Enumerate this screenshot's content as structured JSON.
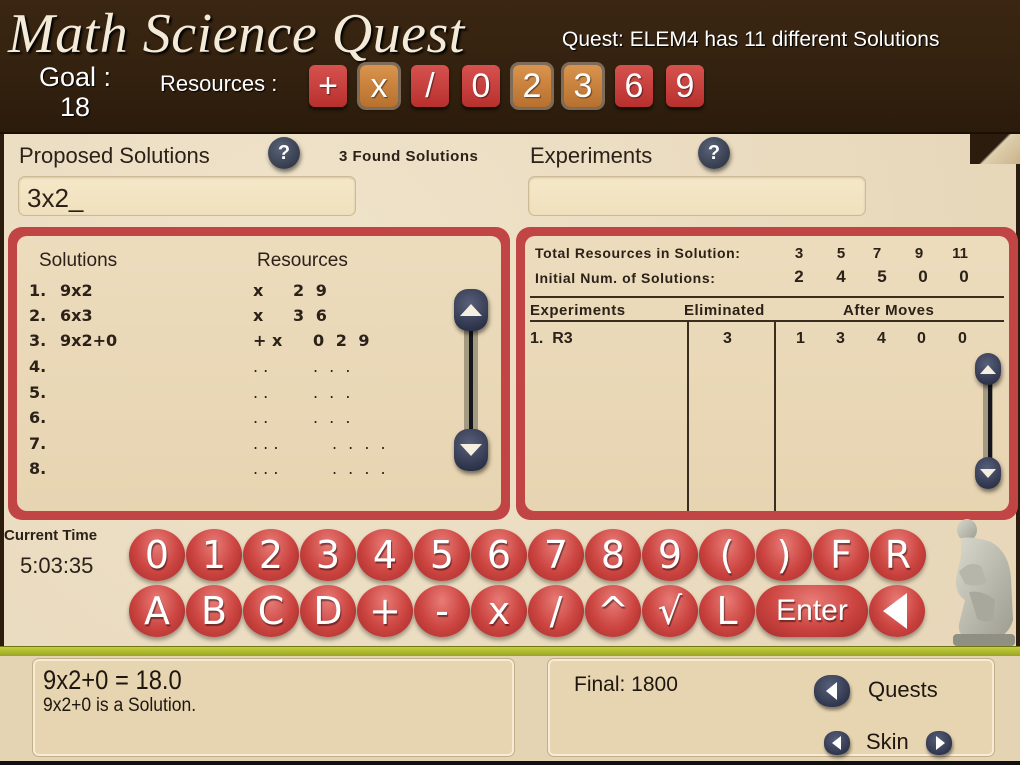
{
  "header": {
    "title": "Math Science Quest",
    "quest_text": "Quest: ELEM4 has 11 different Solutions",
    "goal_label": "Goal :",
    "goal_value": "18",
    "resources_label": "Resources :",
    "resource_tiles": [
      {
        "label": "+",
        "state": "available"
      },
      {
        "label": "x",
        "state": "used"
      },
      {
        "label": "/",
        "state": "available"
      },
      {
        "label": "0",
        "state": "available"
      },
      {
        "label": "2",
        "state": "used"
      },
      {
        "label": "3",
        "state": "used"
      },
      {
        "label": "6",
        "state": "available"
      },
      {
        "label": "9",
        "state": "available"
      }
    ]
  },
  "proposed": {
    "label": "Proposed Solutions",
    "help": "?",
    "found_text": "3 Found Solutions",
    "input_value": "3x2_"
  },
  "experiments_input": {
    "label": "Experiments",
    "help": "?",
    "input_value": ""
  },
  "solutions_panel": {
    "col_solutions": "Solutions",
    "col_resources": "Resources",
    "rows": [
      {
        "num": "1.",
        "expr": "9x2",
        "ops": "x",
        "digits": "2 9"
      },
      {
        "num": "2.",
        "expr": "6x3",
        "ops": "x",
        "digits": "3 6"
      },
      {
        "num": "3.",
        "expr": "9x2+0",
        "ops": "+ x",
        "digits": "0 2 9"
      },
      {
        "num": "4.",
        "expr": "",
        "ops": ". .",
        "digits": ". . ."
      },
      {
        "num": "5.",
        "expr": "",
        "ops": ". .",
        "digits": ". . ."
      },
      {
        "num": "6.",
        "expr": "",
        "ops": ". .",
        "digits": ". . ."
      },
      {
        "num": "7.",
        "expr": "",
        "ops": ". . .",
        "digits": ". . . ."
      },
      {
        "num": "8.",
        "expr": "",
        "ops": ". . .",
        "digits": ". . . ."
      }
    ]
  },
  "experiments_panel": {
    "total_label": "Total Resources in Solution:",
    "total_values": [
      "3",
      "5",
      "7",
      "9",
      "11"
    ],
    "initial_label": "Initial Num. of Solutions:",
    "initial_values": [
      "2",
      "4",
      "5",
      "0",
      "0"
    ],
    "col_experiments": "Experiments",
    "col_eliminated": "Eliminated",
    "col_after": "After Moves",
    "rows": [
      {
        "experiment": "1.  R3",
        "eliminated": "3",
        "after": [
          "1",
          "3",
          "4",
          "0",
          "0"
        ]
      }
    ]
  },
  "clock": {
    "label": "Current Time",
    "value": "5:03:35"
  },
  "keypad": {
    "row1": [
      "0",
      "1",
      "2",
      "3",
      "4",
      "5",
      "6",
      "7",
      "8",
      "9",
      "(",
      ")",
      "F",
      "R"
    ],
    "row2": [
      "A",
      "B",
      "C",
      "D",
      "+",
      "-",
      "x",
      "/",
      "^",
      "√",
      "L"
    ],
    "enter_label": "Enter"
  },
  "message": {
    "main": "9x2+0 = 18.0",
    "sub": "9x2+0 is a Solution."
  },
  "score": {
    "final_text": "Final: 1800",
    "quests_label": "Quests",
    "skin_label": "Skin"
  },
  "colors": {
    "header_bg": "#33210f",
    "parchment": "#eadcc0",
    "panel_frame": "#c24545",
    "key_red": "#cb4440",
    "tile_used": "#c98040",
    "accent_green": "#b5be30"
  }
}
